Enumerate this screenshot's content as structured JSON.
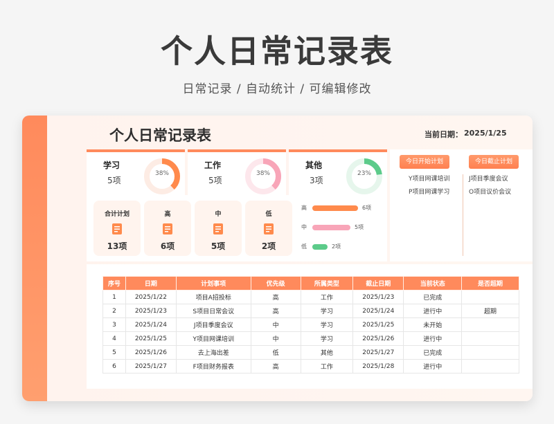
{
  "hero": {
    "title": "个人日常记录表",
    "subtitle": "日常记录 /  自动统计  /  可编辑修改"
  },
  "sheet": {
    "title": "个人日常记录表",
    "date_label": "当前日期：",
    "date_value": "2025/1/25"
  },
  "stats": [
    {
      "name": "学习",
      "count": "5项",
      "percent": "38%",
      "fraction": 0.38,
      "color": "#ff8a4c",
      "track": "#fdece4"
    },
    {
      "name": "工作",
      "count": "5项",
      "percent": "38%",
      "fraction": 0.38,
      "color": "#f8a5b8",
      "track": "#fde7ec"
    },
    {
      "name": "其他",
      "count": "3项",
      "percent": "23%",
      "fraction": 0.23,
      "color": "#5ccb8a",
      "track": "#e6f6ec"
    }
  ],
  "plans": [
    {
      "label": "合计计划",
      "value": "13项"
    },
    {
      "label": "高",
      "value": "6项"
    },
    {
      "label": "中",
      "value": "5项"
    },
    {
      "label": "低",
      "value": "2项"
    }
  ],
  "priority_bars": [
    {
      "label": "高",
      "value_text": "6项",
      "value": 6,
      "color": "#ff8a4c"
    },
    {
      "label": "中",
      "value_text": "5项",
      "value": 5,
      "color": "#f8a5b8"
    },
    {
      "label": "低",
      "value_text": "2项",
      "value": 2,
      "color": "#5ccb8a"
    }
  ],
  "today": {
    "start_button": "今日开始计划",
    "end_button": "今日截止计划",
    "start_items": [
      "Y项目网课培训",
      "P项目网课学习"
    ],
    "end_items": [
      "J项目季度会议",
      "O项目议价会议"
    ]
  },
  "table": {
    "headers": [
      "序号",
      "日期",
      "计划事项",
      "优先级",
      "所属类型",
      "截止日期",
      "当前状态",
      "是否超期"
    ],
    "rows": [
      [
        "1",
        "2025/1/22",
        "项目A招投标",
        "高",
        "工作",
        "2025/1/23",
        "已完成",
        ""
      ],
      [
        "2",
        "2025/1/23",
        "S项目日常会议",
        "高",
        "学习",
        "2025/1/24",
        "进行中",
        "超期"
      ],
      [
        "3",
        "2025/1/24",
        "J项目季度会议",
        "中",
        "学习",
        "2025/1/25",
        "未开始",
        ""
      ],
      [
        "4",
        "2025/1/25",
        "Y项目网课培训",
        "中",
        "学习",
        "2025/1/26",
        "进行中",
        ""
      ],
      [
        "5",
        "2025/1/26",
        "去上海出差",
        "低",
        "其他",
        "2025/1/27",
        "已完成",
        ""
      ],
      [
        "6",
        "2025/1/27",
        "F项目财务报表",
        "高",
        "工作",
        "2025/1/28",
        "进行中",
        ""
      ]
    ]
  },
  "colors": {
    "accent": "#ff8a5c"
  }
}
